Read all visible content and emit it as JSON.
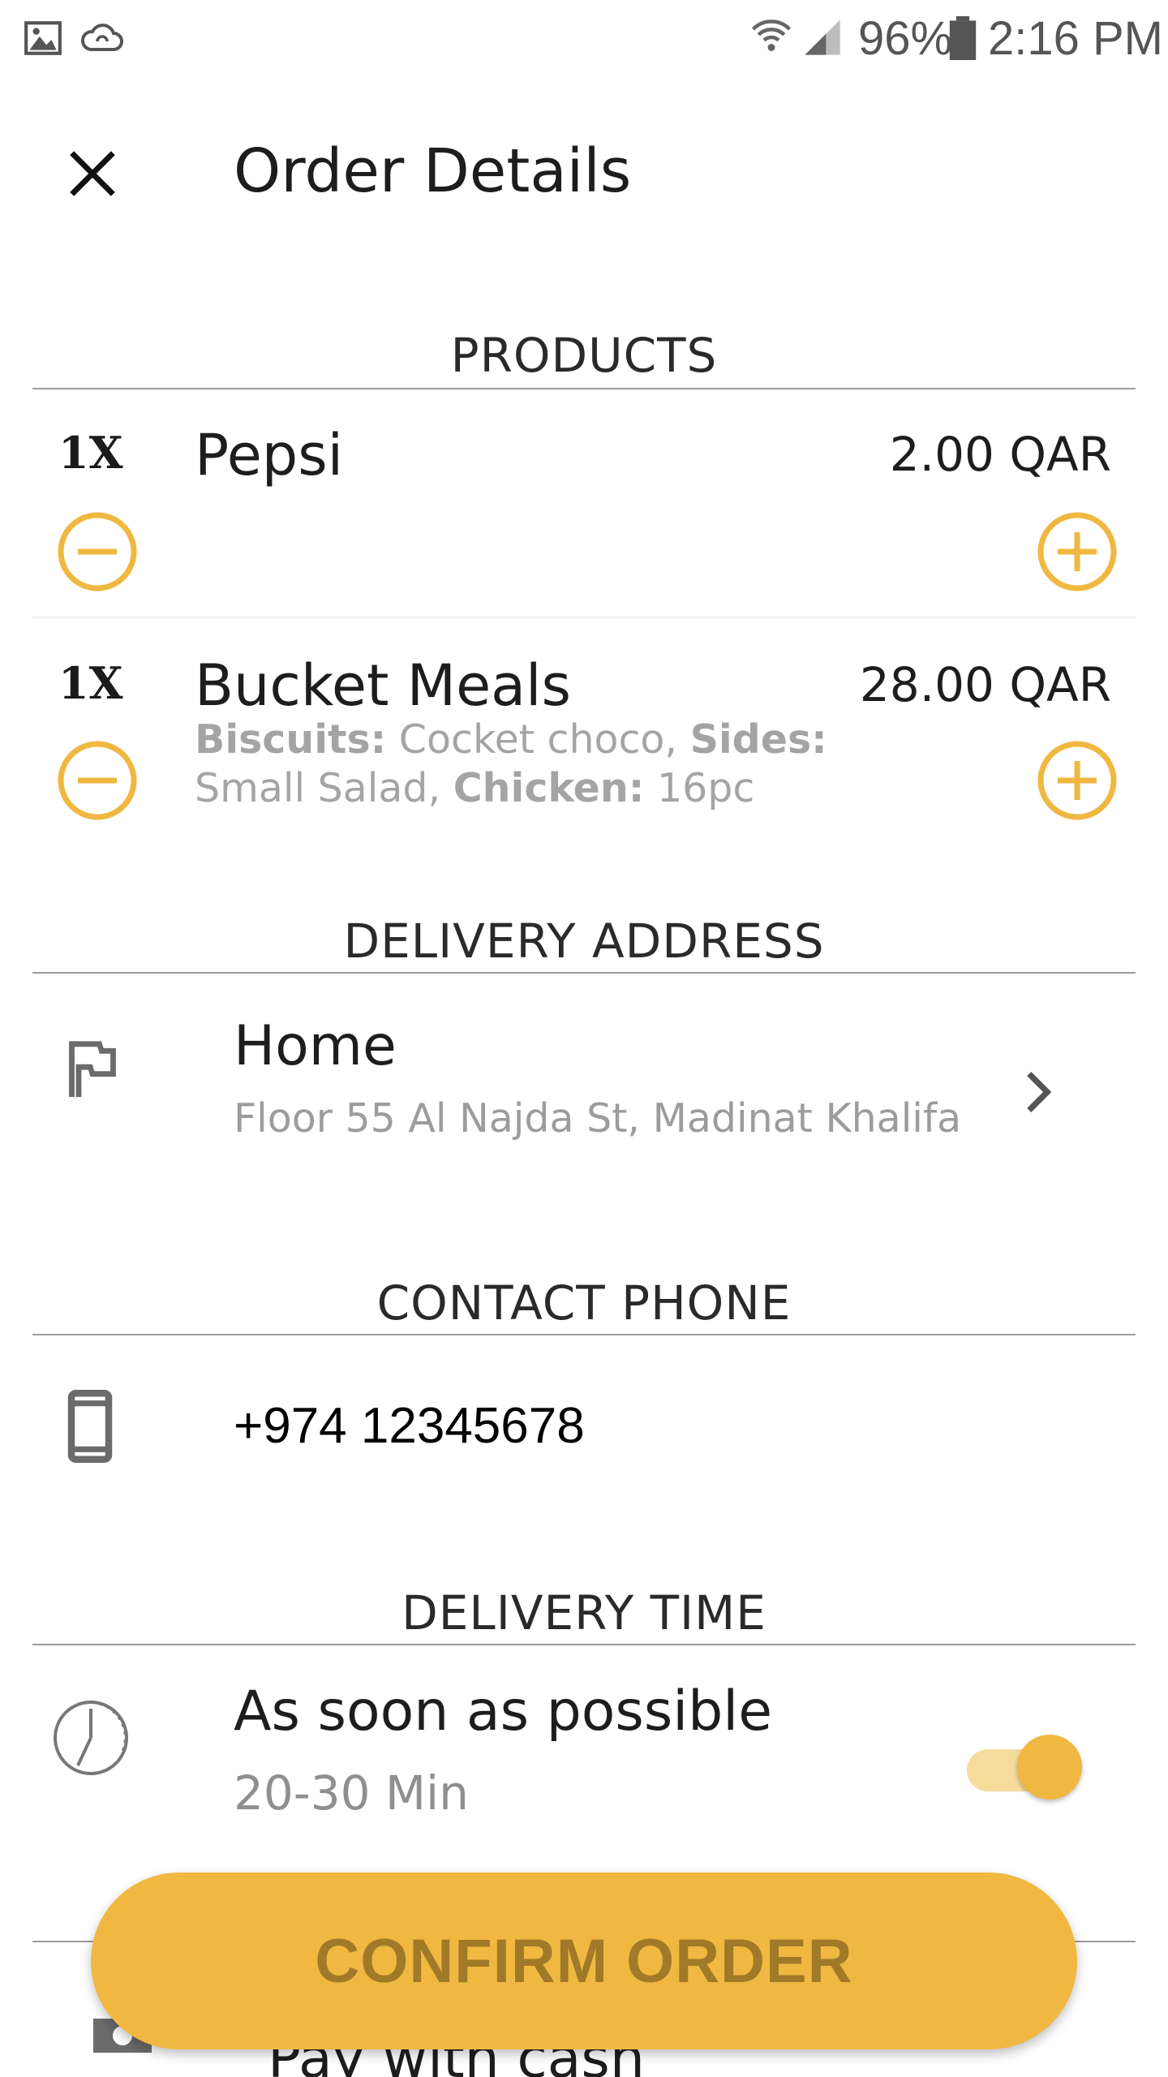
{
  "status_bar": {
    "battery": "96%",
    "time": "2:16 PM",
    "icons": [
      "image-icon",
      "cloud-sync-icon",
      "wifi-icon",
      "signal-icon",
      "battery-icon"
    ]
  },
  "header": {
    "title": "Order Details",
    "close_icon": "close-icon"
  },
  "sections": {
    "products": "PRODUCTS",
    "delivery_address": "DELIVERY ADDRESS",
    "contact_phone": "CONTACT PHONE",
    "delivery_time": "DELIVERY TIME"
  },
  "products": [
    {
      "qty": "1X",
      "name": "Pepsi",
      "price": "2.00 QAR"
    },
    {
      "qty": "1X",
      "name": "Bucket Meals",
      "price": "28.00 QAR",
      "options": [
        {
          "label": "Biscuits:",
          "value": " Cocket choco, "
        },
        {
          "label": "Sides:",
          "value": " Small Salad, "
        },
        {
          "label": "Chicken:",
          "value": " 16pc"
        }
      ]
    }
  ],
  "address": {
    "title": "Home",
    "detail": "Floor 55 Al Najda St, Madinat Khalifa"
  },
  "phone": {
    "number": "+974 12345678"
  },
  "delivery_time": {
    "title": "As soon as possible",
    "detail": "20-30 Min",
    "toggle_on": true
  },
  "payment": {
    "label": "Pay with cash"
  },
  "confirm_button": "CONFIRM ORDER",
  "colors": {
    "accent": "#f0b841",
    "confirm_text": "#a07a28",
    "muted_text": "#9c9c9c"
  }
}
